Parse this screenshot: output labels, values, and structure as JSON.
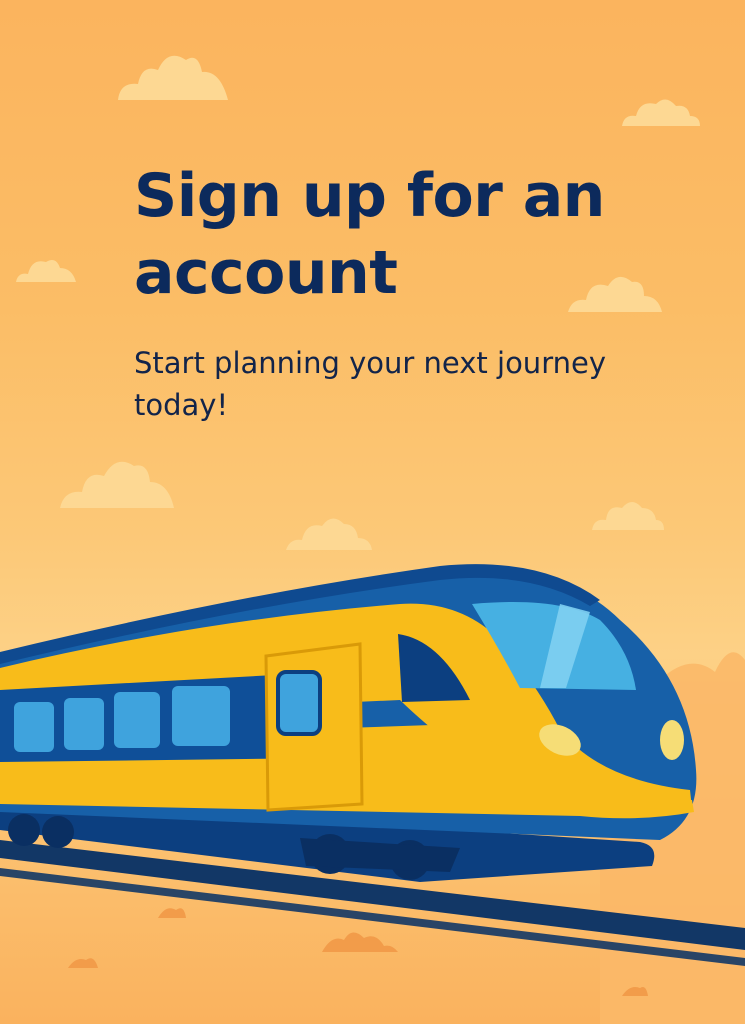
{
  "signup": {
    "title": "Sign up for an account",
    "subtitle": "Start planning your next journey today!"
  },
  "illustration": {
    "subject": "train-illustration",
    "colors": {
      "background": "#fbb45e",
      "title_text": "#0c2a5c",
      "train_blue": "#1760a8",
      "train_dark_blue": "#0c3f80",
      "train_yellow": "#f8bc1a",
      "window": "#3fa3dd",
      "rail": "#123766",
      "cloud": "#fdd893"
    }
  }
}
